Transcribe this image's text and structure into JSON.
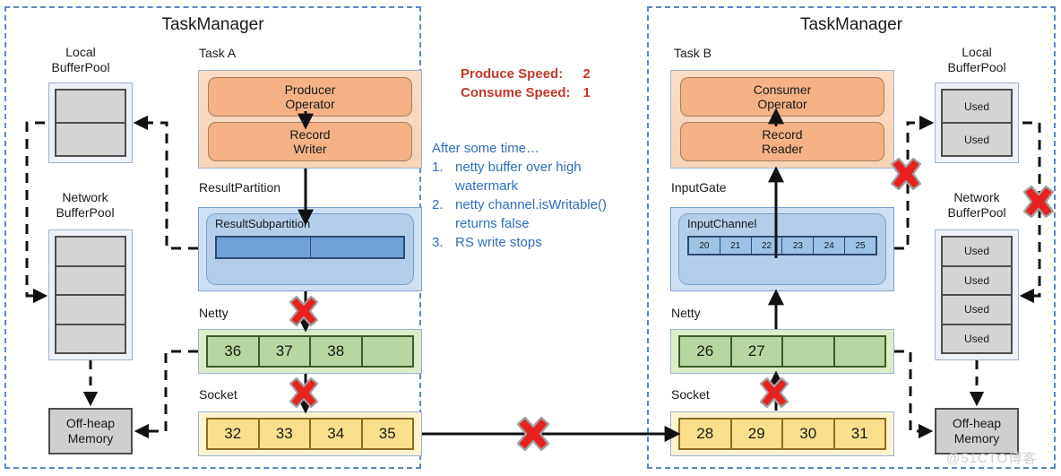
{
  "left_panel": {
    "title": "TaskManager",
    "local_pool_label": "Local\nBufferPool",
    "local_pool_label_l1": "Local",
    "local_pool_label_l2": "BufferPool",
    "local_pool_cells": [
      "",
      ""
    ],
    "network_pool_label_l1": "Network",
    "network_pool_label_l2": "BufferPool",
    "network_pool_cells": [
      "",
      "",
      "",
      ""
    ],
    "offheap_l1": "Off-heap",
    "offheap_l2": "Memory",
    "task_label": "Task A",
    "operator_1_l1": "Producer",
    "operator_1_l2": "Operator",
    "operator_2_l1": "Record",
    "operator_2_l2": "Writer",
    "result_partition_label": "ResultPartition",
    "result_subpartition_caption": "ResultSubpartition",
    "result_subpartition_cells": [
      "",
      ""
    ],
    "netty_label": "Netty",
    "netty_cells": [
      "36",
      "37",
      "38",
      ""
    ],
    "socket_label": "Socket",
    "socket_cells": [
      "32",
      "33",
      "34",
      "35"
    ]
  },
  "right_panel": {
    "title": "TaskManager",
    "local_pool_label_l1": "Local",
    "local_pool_label_l2": "BufferPool",
    "local_pool_cells": [
      "Used",
      "Used"
    ],
    "network_pool_label_l1": "Network",
    "network_pool_label_l2": "BufferPool",
    "network_pool_cells": [
      "Used",
      "Used",
      "Used",
      "Used"
    ],
    "offheap_l1": "Off-heap",
    "offheap_l2": "Memory",
    "task_label": "Task B",
    "operator_1_l1": "Consumer",
    "operator_1_l2": "Operator",
    "operator_2_l1": "Record",
    "operator_2_l2": "Reader",
    "input_gate_label": "InputGate",
    "input_channel_caption": "InputChannel",
    "input_channel_cells": [
      "20",
      "21",
      "22",
      "23",
      "24",
      "25"
    ],
    "netty_label": "Netty",
    "netty_cells": [
      "26",
      "27",
      "",
      ""
    ],
    "socket_label": "Socket",
    "socket_cells": [
      "28",
      "29",
      "30",
      "31"
    ]
  },
  "annotation": {
    "produce_label": "Produce Speed:",
    "produce_value": "2",
    "consume_label": "Consume Speed:",
    "consume_value": "1",
    "after_title": "After some time…",
    "steps": [
      {
        "n": "1.",
        "text": "netty buffer over high watermark"
      },
      {
        "n": "2.",
        "text": "netty channel.isWritable() returns false"
      },
      {
        "n": "3.",
        "text": "RS write stops"
      }
    ]
  },
  "watermark": "@51CTO博客",
  "colors": {
    "panel_border": "#5b87c7",
    "red_x": "#e8201f",
    "red_text": "#c0392b",
    "blue_text": "#2e6fba",
    "orange_box": "#f5b183",
    "blue_box": "#6fa2d8",
    "green_box": "#b8d6a0",
    "yellow_box": "#fbdf8c",
    "grey_box": "#d4d4d4"
  }
}
